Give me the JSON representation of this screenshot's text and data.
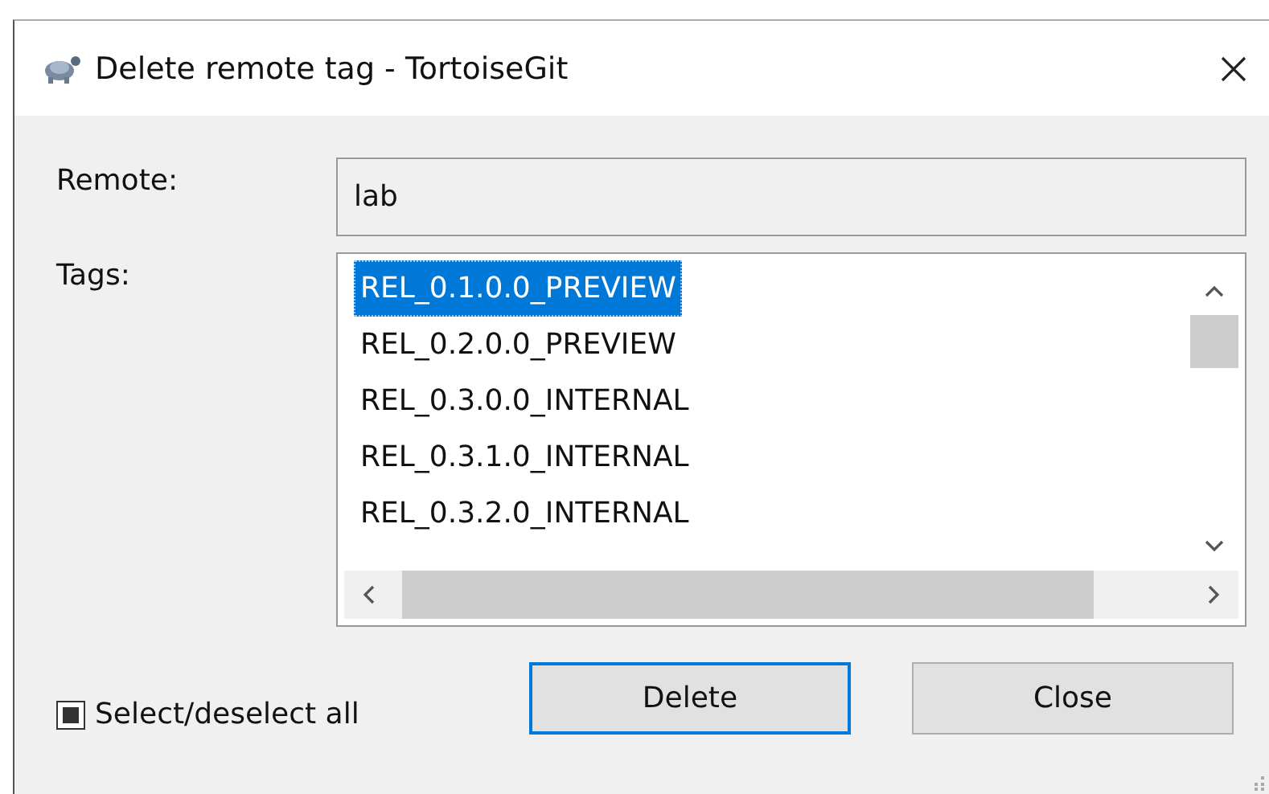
{
  "window": {
    "title": "Delete remote tag - TortoiseGit"
  },
  "remote": {
    "label": "Remote:",
    "value": "lab"
  },
  "tags": {
    "label": "Tags:",
    "items": [
      {
        "name": "REL_0.1.0.0_PREVIEW",
        "selected": true
      },
      {
        "name": "REL_0.2.0.0_PREVIEW",
        "selected": false
      },
      {
        "name": "REL_0.3.0.0_INTERNAL",
        "selected": false
      },
      {
        "name": "REL_0.3.1.0_INTERNAL",
        "selected": false
      },
      {
        "name": "REL_0.3.2.0_INTERNAL",
        "selected": false
      }
    ]
  },
  "select_all": {
    "label": "Select/deselect all",
    "indeterminate": true
  },
  "buttons": [
    {
      "label": "Delete",
      "default": true
    },
    {
      "label": "Close",
      "default": false
    }
  ]
}
